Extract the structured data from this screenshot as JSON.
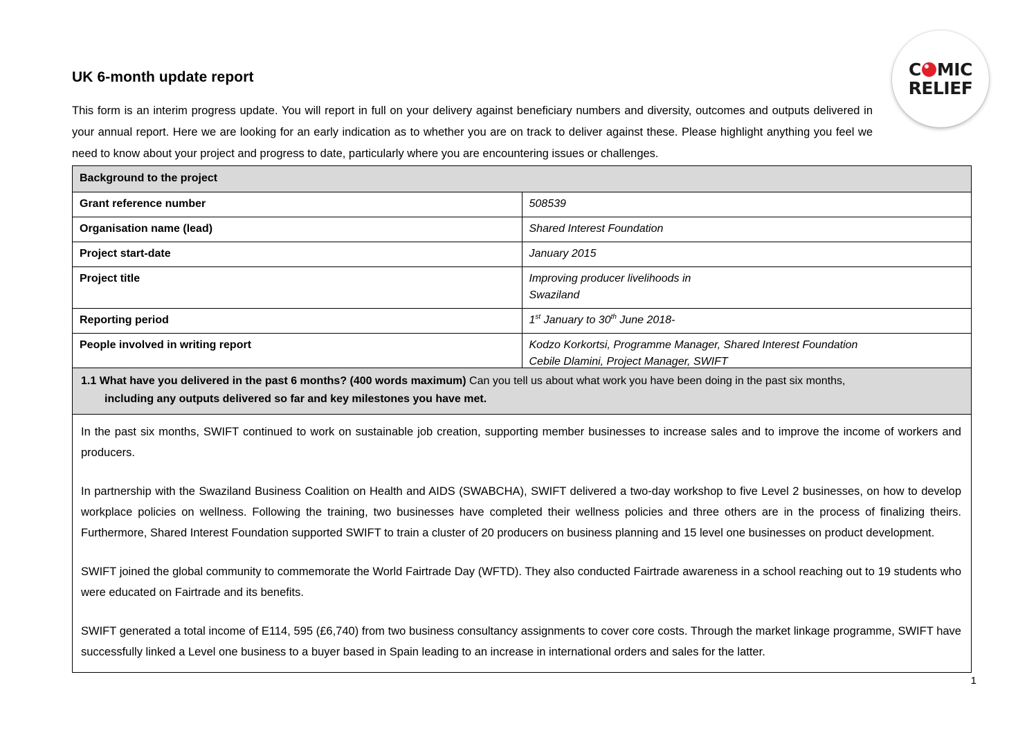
{
  "document": {
    "title": "UK 6-month update report",
    "intro": "This form is an interim progress update. You will report in full on your delivery against beneficiary numbers and diversity, outcomes and outputs delivered in your annual report. Here we are looking for an early indication as to whether you are on track to deliver against these.  Please highlight anything you feel we need to know about your project and progress to date, particularly where you are encountering issues or challenges.",
    "page_number": "1"
  },
  "logo": {
    "line1_before": "C",
    "line1_after": "MIC",
    "line2": "RELIEF",
    "nose_color": "#e1202a",
    "text_color": "#1a1a1a"
  },
  "background_table": {
    "header": "Background to the project",
    "header_bg": "#d9d9d9",
    "rows": [
      {
        "label": "Grant reference number",
        "value": "508539"
      },
      {
        "label": "Organisation name (lead)",
        "value": "Shared Interest Foundation"
      },
      {
        "label": "Project start-date",
        "value": " January 2015"
      },
      {
        "label": "Project title",
        "value": "Improving producer livelihoods in\nSwaziland"
      },
      {
        "label": "Reporting period",
        "value": "1st January to 30th June 2018-"
      },
      {
        "label": "People involved in writing report",
        "value": "Kodzo Korkortsi, Programme Manager, Shared Interest Foundation\nCebile Dlamini, Project Manager, SWIFT"
      }
    ],
    "reporting_period_parts": {
      "a": "1",
      "sup_a": "st",
      "b": " January to 30",
      "sup_b": "th",
      "c": " June 2018-"
    }
  },
  "question_1_1": {
    "number": "1.1",
    "bold_part": "What have you delivered in the past 6 months? (400 words maximum)",
    "normal_part": " Can you tell us about what work you have been doing in the past six months,",
    "line2": "including any outputs delivered so far and key milestones you have met.",
    "header_bg": "#d9d9d9",
    "answer_paragraphs": [
      "In the past six months, SWIFT continued to work on sustainable job creation, supporting member businesses to increase sales and to improve the income of workers and producers.",
      "In partnership with the Swaziland Business Coalition on Health and AIDS (SWABCHA), SWIFT delivered a two-day workshop to five Level 2 businesses, on how to develop workplace policies on wellness. Following the training, two businesses have completed their wellness policies and three others are in the process of finalizing theirs. Furthermore, Shared Interest Foundation supported SWIFT to train a cluster of 20 producers on business planning and 15 level one businesses on product development.",
      "SWIFT joined the global community to commemorate the World Fairtrade Day (WFTD).  They also conducted Fairtrade awareness in a school reaching out to 19 students who were educated on Fairtrade and its benefits.",
      "SWIFT generated a total income of E114, 595 (£6,740) from two business consultancy assignments to cover core costs. Through the market linkage programme, SWIFT have successfully linked a Level one business to a buyer based in Spain leading to an increase in international orders and sales for the latter."
    ]
  }
}
